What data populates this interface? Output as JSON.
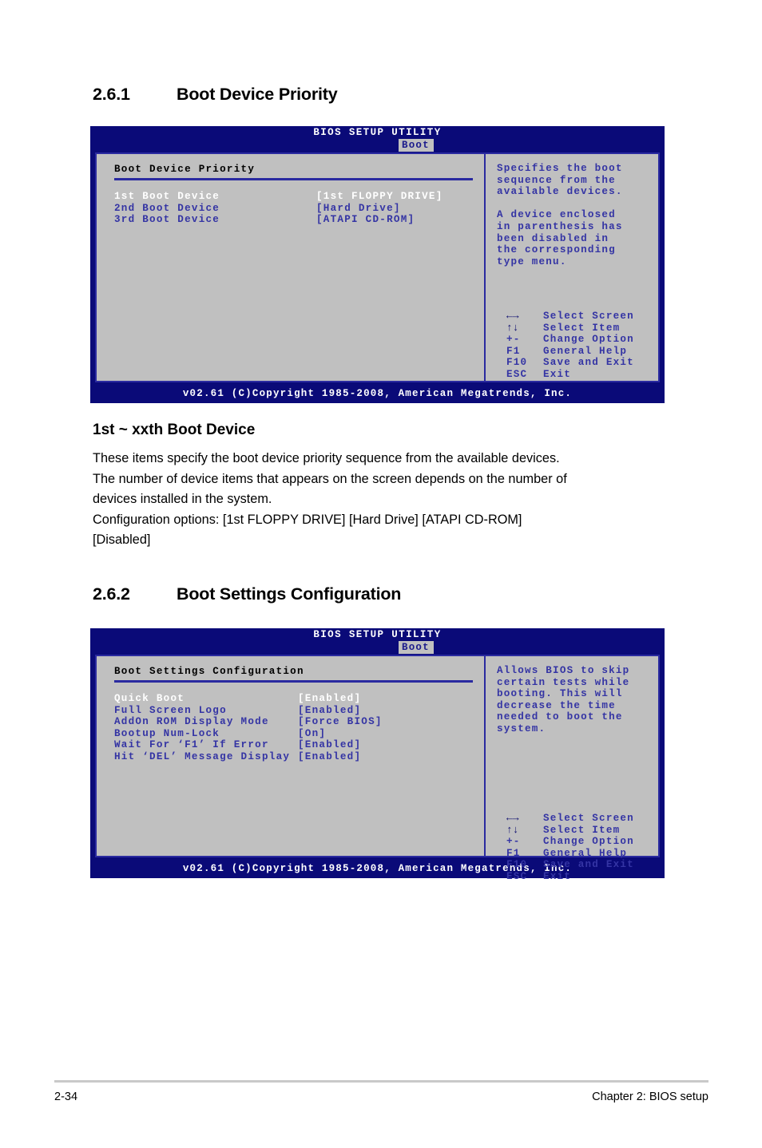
{
  "document": {
    "page_number": "2-34",
    "chapter": "Chapter 2: BIOS setup"
  },
  "sections": [
    {
      "number": "2.6.1",
      "title": "Boot Device Priority"
    },
    {
      "number": "2.6.2",
      "title": "Boot Settings Configuration"
    }
  ],
  "bios_screen_1": {
    "title": "BIOS SETUP UTILITY",
    "tab": "Boot",
    "panel_title": "Boot Device Priority",
    "items": [
      {
        "label": "1st Boot Device",
        "value": "[1st FLOPPY DRIVE]",
        "selected": true
      },
      {
        "label": "2nd Boot Device",
        "value": "[Hard Drive]",
        "selected": false
      },
      {
        "label": "3rd Boot Device",
        "value": "[ATAPI CD-ROM]",
        "selected": false
      }
    ],
    "help_paragraph_1": "Specifies the boot\nsequence from the\navailable devices.",
    "help_paragraph_2": "A device enclosed\nin parenthesis has\nbeen disabled in\nthe corresponding\ntype menu.",
    "nav_keys": [
      {
        "key": "←→",
        "desc": "Select Screen",
        "glyph": true
      },
      {
        "key": "↑↓",
        "desc": "Select Item",
        "glyph": true
      },
      {
        "key": "+-",
        "desc": "Change Option",
        "glyph": false
      },
      {
        "key": "F1",
        "desc": "General Help",
        "glyph": false
      },
      {
        "key": "F10",
        "desc": "Save and Exit",
        "glyph": false
      },
      {
        "key": "ESC",
        "desc": "Exit",
        "glyph": false
      }
    ],
    "footer": "v02.61 (C)Copyright 1985-2008, American Megatrends, Inc."
  },
  "bios_screen_2": {
    "title": "BIOS SETUP UTILITY",
    "tab": "Boot",
    "panel_title": "Boot Settings Configuration",
    "items": [
      {
        "label": "Quick Boot",
        "value": "[Enabled]",
        "selected": true
      },
      {
        "label": "Full Screen Logo",
        "value": "[Enabled]",
        "selected": false
      },
      {
        "label": "AddOn ROM Display Mode",
        "value": "[Force BIOS]",
        "selected": false
      },
      {
        "label": "Bootup Num-Lock",
        "value": "[On]",
        "selected": false
      },
      {
        "label": "Wait For ‘F1’ If Error",
        "value": "[Enabled]",
        "selected": false
      },
      {
        "label": "Hit ‘DEL’ Message Display",
        "value": "[Enabled]",
        "selected": false
      }
    ],
    "help_paragraph_1": "Allows BIOS to skip\ncertain tests while\nbooting. This will\ndecrease the time\nneeded to boot the\nsystem.",
    "nav_keys": [
      {
        "key": "←→",
        "desc": "Select Screen",
        "glyph": true
      },
      {
        "key": "↑↓",
        "desc": "Select Item",
        "glyph": true
      },
      {
        "key": "+-",
        "desc": "Change Option",
        "glyph": false
      },
      {
        "key": "F1",
        "desc": "General Help",
        "glyph": false
      },
      {
        "key": "F10",
        "desc": "Save and Exit",
        "glyph": false
      },
      {
        "key": "ESC",
        "desc": "Exit",
        "glyph": false
      }
    ],
    "footer": "v02.61 (C)Copyright 1985-2008, American Megatrends, Inc."
  },
  "prose_block": {
    "heading": "1st ~ xxth Boot Device",
    "lines": [
      "These items specify the boot device priority sequence from the available devices.",
      "The number of device items that appears on the screen depends on the number of",
      "devices installed in the system.",
      "Configuration options: [1st FLOPPY DRIVE] [Hard Drive] [ATAPI CD-ROM]",
      "[Disabled]"
    ]
  }
}
